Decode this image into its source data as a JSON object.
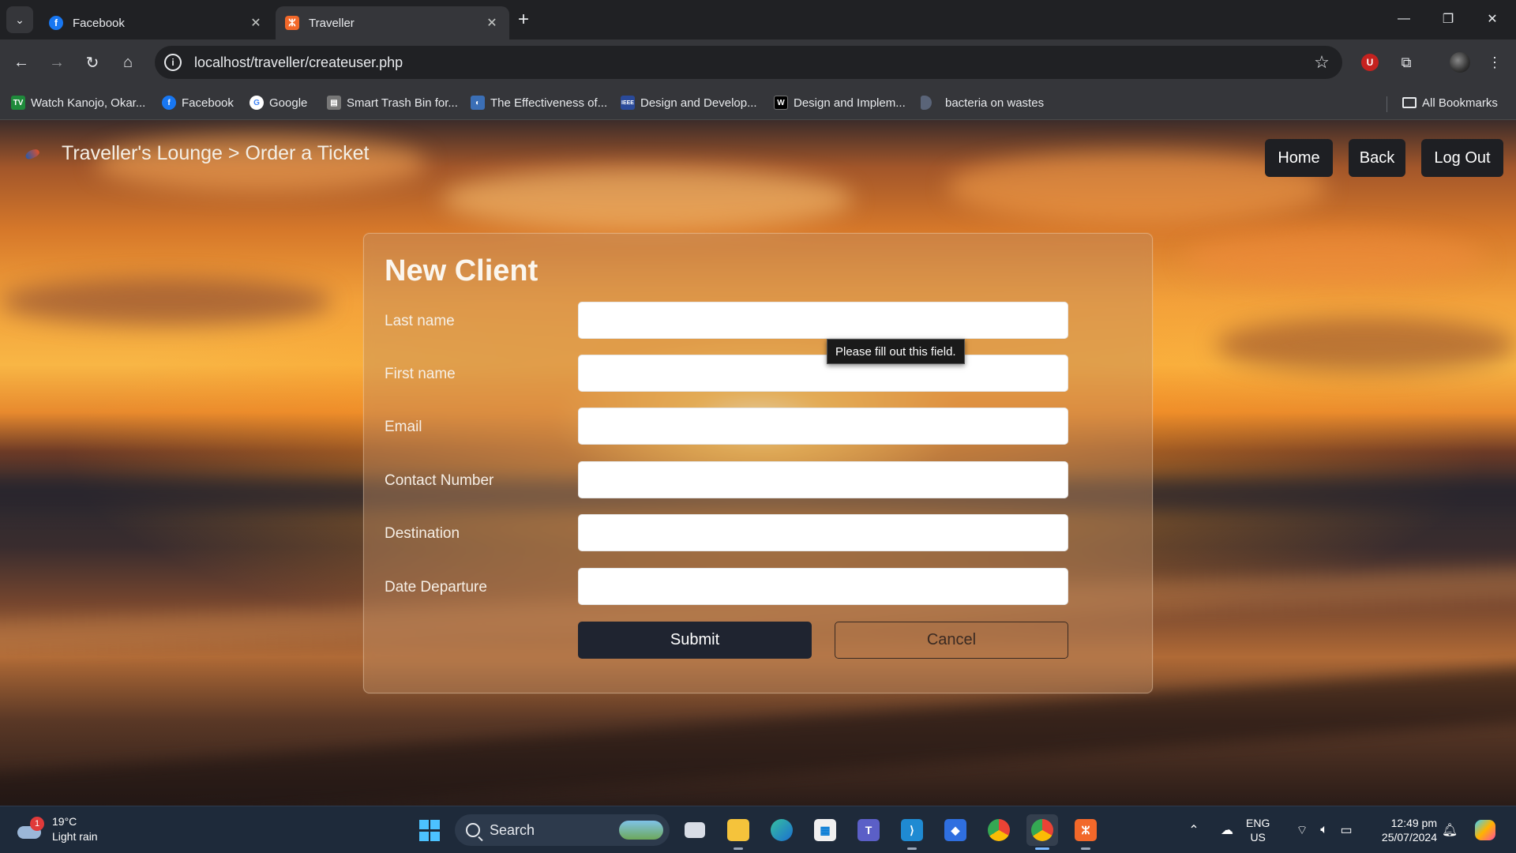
{
  "browser": {
    "tabs": [
      {
        "title": "Facebook",
        "icon": "facebook-icon",
        "active": false
      },
      {
        "title": "Traveller",
        "icon": "xampp-icon",
        "active": true
      }
    ],
    "url": "localhost/traveller/createuser.php",
    "bookmarks": [
      {
        "label": "Watch Kanojo, Okar...",
        "icon": "tv-icon",
        "color": "#1f8a3b"
      },
      {
        "label": "Facebook",
        "icon": "facebook-icon",
        "color": "#1877f2"
      },
      {
        "label": "Google",
        "icon": "google-icon",
        "color": "#ffffff"
      },
      {
        "label": "Smart Trash Bin for...",
        "icon": "document-icon",
        "color": "#888888"
      },
      {
        "label": "The Effectiveness of...",
        "icon": "globe-icon",
        "color": "#3b6fb6"
      },
      {
        "label": "Design and Develop...",
        "icon": "ieee-icon",
        "color": "#2a4a9a"
      },
      {
        "label": "Design and Implem...",
        "icon": "w-icon",
        "color": "#000000"
      },
      {
        "label": "bacteria on wastes",
        "icon": "page-icon",
        "color": "#5a6478"
      }
    ],
    "all_bookmarks": "All Bookmarks"
  },
  "site": {
    "brand": "Traveller's Lounge > Order a Ticket",
    "nav": {
      "home": "Home",
      "back": "Back",
      "logout": "Log Out"
    }
  },
  "form": {
    "title": "New Client",
    "fields": [
      {
        "label": "Last name",
        "value": ""
      },
      {
        "label": "First name",
        "value": ""
      },
      {
        "label": "Email",
        "value": ""
      },
      {
        "label": "Contact Number",
        "value": ""
      },
      {
        "label": "Destination",
        "value": ""
      },
      {
        "label": "Date Departure",
        "value": ""
      }
    ],
    "submit": "Submit",
    "cancel": "Cancel",
    "validation_tooltip": "Please fill out this field."
  },
  "taskbar": {
    "weather": {
      "temp": "19°C",
      "condition": "Light rain",
      "badge": "1"
    },
    "search": "Search",
    "lang": {
      "line1": "ENG",
      "line2": "US"
    },
    "clock": {
      "time": "12:49 pm",
      "date": "25/07/2024"
    }
  },
  "colors": {
    "chrome_bg": "#202124",
    "toolbar_bg": "#35363a",
    "submit_bg": "#1f2430",
    "nav_pill_bg": "#1e1f23"
  }
}
